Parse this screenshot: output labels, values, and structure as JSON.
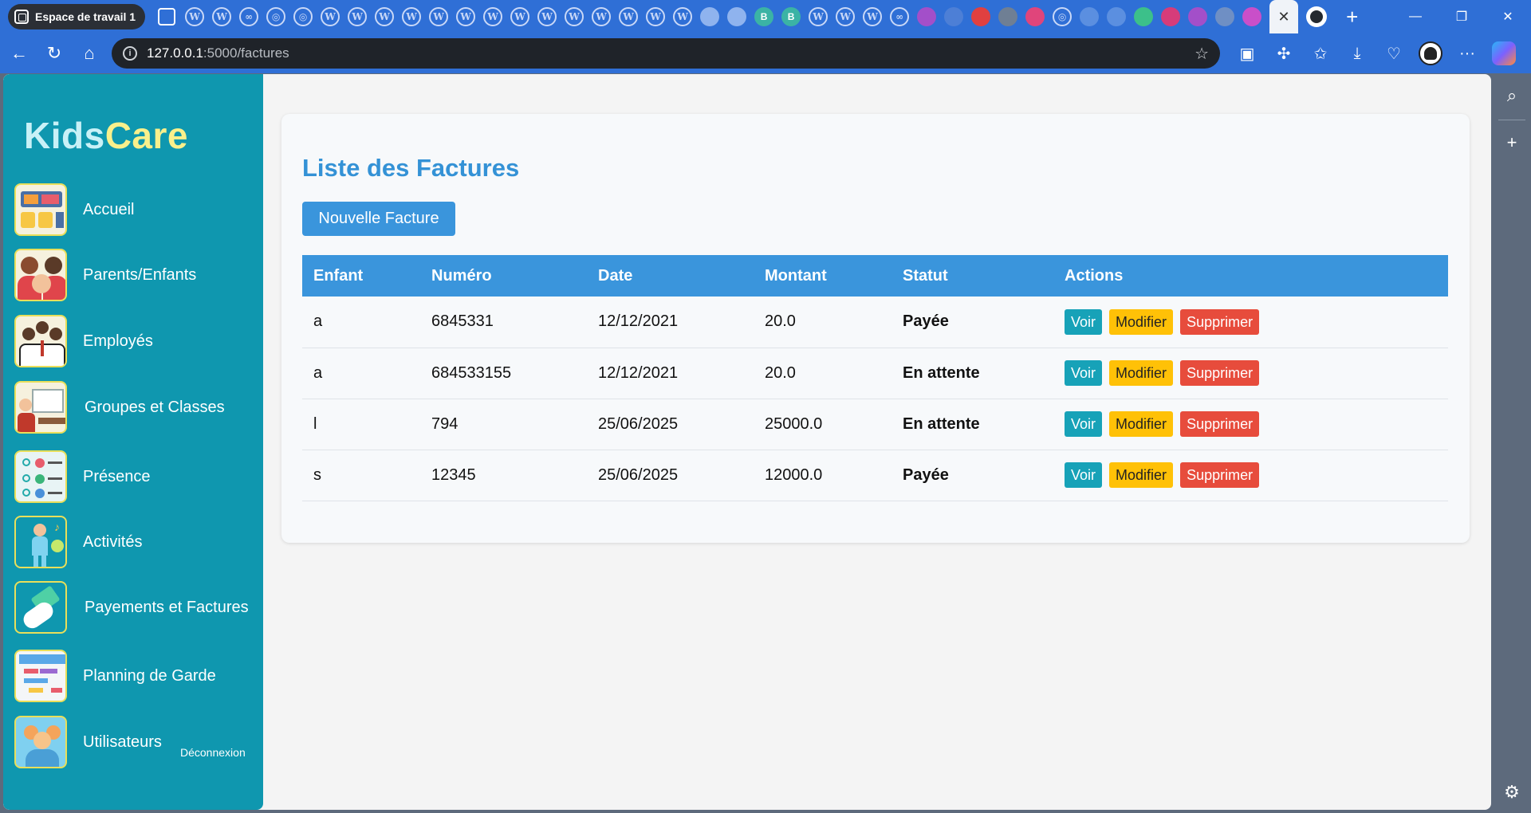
{
  "browser": {
    "workspace_label": "Espace de travail 1",
    "url_host": "127.0.0.1",
    "url_path": ":5000/factures",
    "tab_favicons": [
      "wp",
      "wp",
      "wp",
      "wp",
      "wp",
      "wp",
      "wp",
      "wp",
      "wp",
      "wp",
      "wp",
      "wp",
      "wp",
      "wp",
      "wp",
      "wp",
      "wp",
      "wp",
      "wp",
      "wp"
    ],
    "bing_letter": "B"
  },
  "brand": {
    "part1": "Kids",
    "part2": "Care"
  },
  "nav": {
    "home": "Accueil",
    "parents": "Parents/Enfants",
    "staff": "Employés",
    "groups": "Groupes et Classes",
    "attendance": "Présence",
    "activities": "Activités",
    "payments": "Payements et Factures",
    "planning": "Planning de Garde",
    "users": "Utilisateurs",
    "logout": "Déconnexion"
  },
  "page": {
    "title": "Liste des Factures",
    "new_button": "Nouvelle Facture"
  },
  "table": {
    "headers": {
      "child": "Enfant",
      "number": "Numéro",
      "date": "Date",
      "amount": "Montant",
      "status": "Statut",
      "actions": "Actions"
    },
    "rows": [
      {
        "child": "a",
        "number": "6845331",
        "date": "12/12/2021",
        "amount": "20.0",
        "status": "Payée"
      },
      {
        "child": "a",
        "number": "684533155",
        "date": "12/12/2021",
        "amount": "20.0",
        "status": "En attente"
      },
      {
        "child": "l",
        "number": "794",
        "date": "25/06/2025",
        "amount": "25000.0",
        "status": "En attente"
      },
      {
        "child": "s",
        "number": "12345",
        "date": "25/06/2025",
        "amount": "12000.0",
        "status": "Payée"
      }
    ],
    "action_labels": {
      "view": "Voir",
      "edit": "Modifier",
      "delete": "Supprimer"
    }
  },
  "colors": {
    "sidebar": "#0f97af",
    "accent": "#3a95dc",
    "paid": "#2fbf63",
    "pending": "#ef9a1c",
    "view": "#17a2b8",
    "edit": "#ffc107",
    "delete": "#e74c3c"
  }
}
